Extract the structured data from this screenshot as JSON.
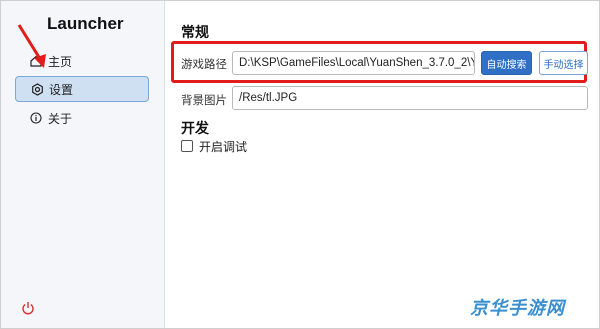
{
  "sidebar": {
    "title": "Launcher",
    "items": [
      {
        "label": "主页",
        "icon": "home-icon"
      },
      {
        "label": "设置",
        "icon": "settings-icon"
      },
      {
        "label": "关于",
        "icon": "info-icon"
      }
    ],
    "power_icon": "power-icon"
  },
  "general": {
    "title": "常规",
    "game_path_label": "游戏路径",
    "game_path_value": "D:\\KSP\\GameFiles\\Local\\YuanShen_3.7.0_2\\Y",
    "auto_search_label": "自动搜索",
    "manual_select_label": "手动选择",
    "bg_label": "背景图片",
    "bg_value": "/Res/tl.JPG"
  },
  "dev": {
    "title": "开发",
    "debug_label": "开启调试",
    "debug_checked": false
  },
  "watermark": "京华手游网",
  "colors": {
    "accent": "#2f6fc6",
    "highlight": "#e21b1b",
    "watermark": "#3a8fd0"
  }
}
